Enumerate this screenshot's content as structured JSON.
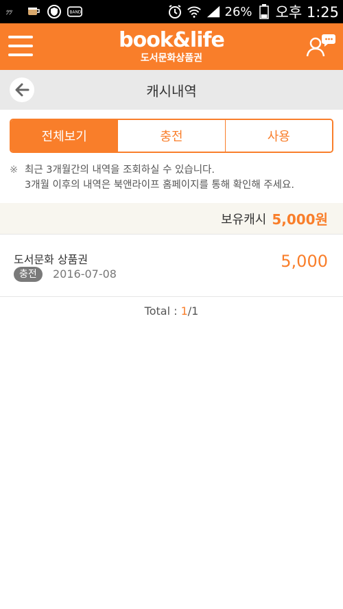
{
  "status_bar": {
    "battery": "26%",
    "time": "오후 1:25",
    "notif_band": "BAND"
  },
  "header": {
    "logo_text": "book&life",
    "logo_subtitle": "도서문화상품권"
  },
  "page": {
    "title": "캐시내역"
  },
  "tabs": [
    {
      "label": "전체보기",
      "active": true
    },
    {
      "label": "충전",
      "active": false
    },
    {
      "label": "사용",
      "active": false
    }
  ],
  "notice": {
    "mark": "※",
    "line1": "최근 3개월간의 내역을 조회하실 수 있습니다.",
    "line2": "3개월 이후의 내역은 북앤라이프 홈페이지를 통해 확인해 주세요."
  },
  "balance": {
    "label": "보유캐시",
    "value": "5,000원"
  },
  "transactions": [
    {
      "title": "도서문화 상품권",
      "type": "충전",
      "date": "2016-07-08",
      "amount": "5,000"
    }
  ],
  "pager": {
    "prefix": "Total : ",
    "current": "1",
    "separator_total": "/1"
  },
  "colors": {
    "accent": "#f97e2a",
    "status_bar": "#000000",
    "title_bar": "#e9e9e9"
  },
  "icons": {
    "menu": "hamburger-icon",
    "user": "user-chat-icon",
    "back": "back-arrow-icon"
  }
}
